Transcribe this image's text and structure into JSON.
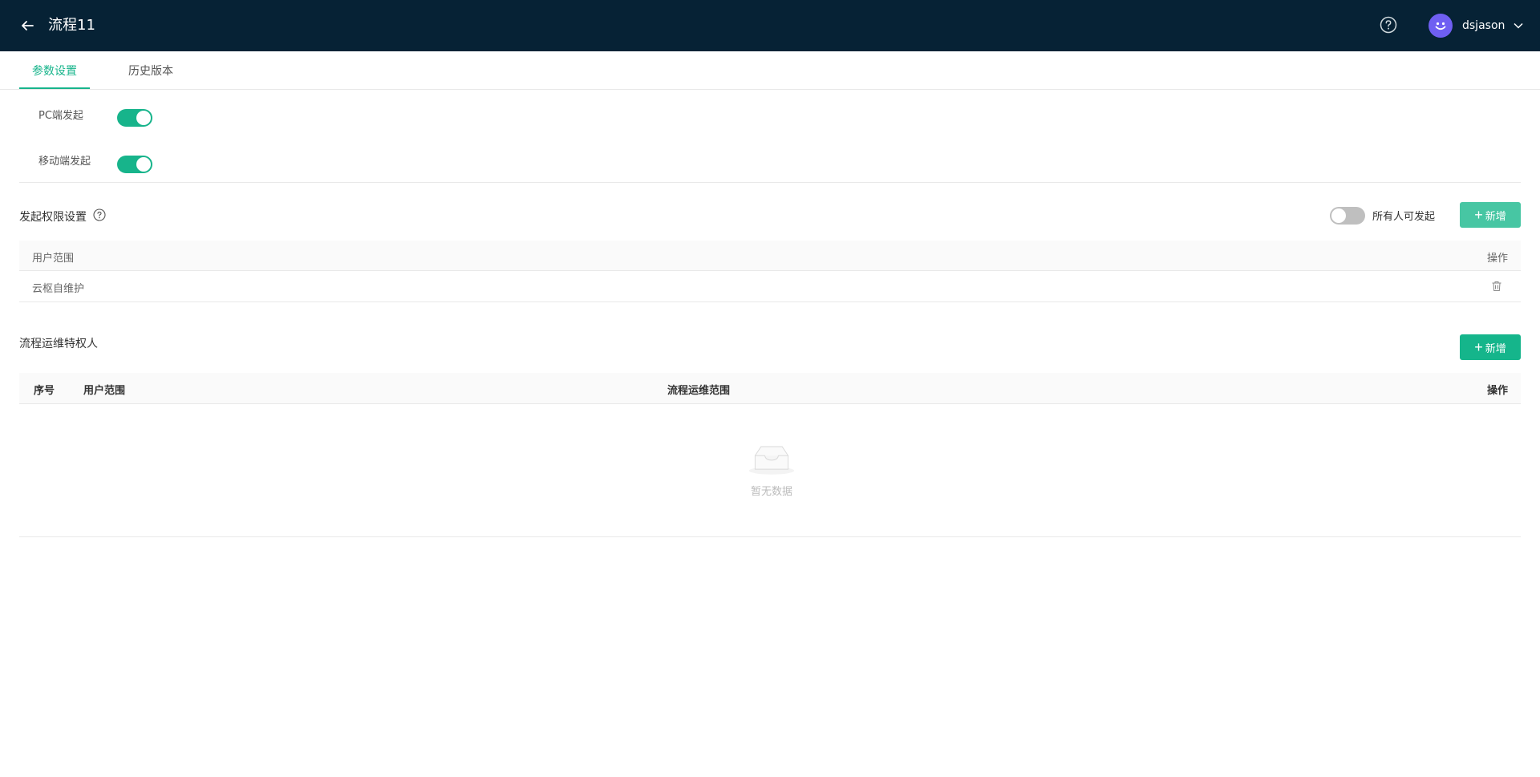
{
  "header": {
    "title": "流程11",
    "username": "dsjason",
    "colors": {
      "background": "#062235",
      "avatar": "#6f5ff2"
    }
  },
  "tabs": [
    {
      "label": "参数设置",
      "active": true
    },
    {
      "label": "历史版本",
      "active": false
    }
  ],
  "launch": {
    "pc_label": "PC端发起",
    "pc_enabled": true,
    "mobile_label": "移动端发起",
    "mobile_enabled": true
  },
  "permission": {
    "title": "发起权限设置",
    "everyone_label": "所有人可发起",
    "everyone_enabled": false,
    "add_label": "新增",
    "columns": {
      "scope": "用户范围",
      "action": "操作"
    },
    "rows": [
      {
        "scope": "云枢自维护"
      }
    ]
  },
  "ops": {
    "title": "流程运维特权人",
    "add_label": "新增",
    "columns": {
      "index": "序号",
      "scope": "用户范围",
      "ops_scope": "流程运维范围",
      "action": "操作"
    },
    "rows": [],
    "empty_text": "暂无数据"
  },
  "accent_color": "#17b48b"
}
